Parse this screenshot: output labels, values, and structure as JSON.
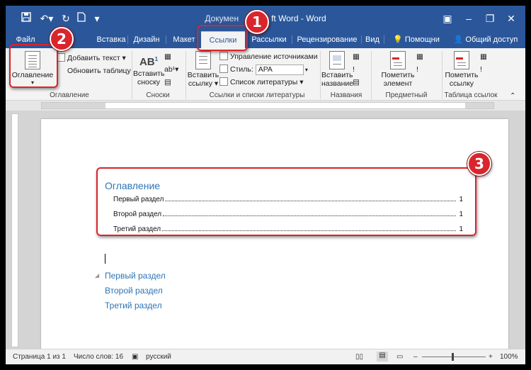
{
  "titlebar": {
    "title_prefix": "Докумен",
    "title_suffix": "ft Word - Word"
  },
  "tabs": [
    {
      "label": "Файл"
    },
    {
      "label": "Вставка"
    },
    {
      "label": "Дизайн"
    },
    {
      "label": "Макет"
    },
    {
      "label": "Ссылки",
      "active": true
    },
    {
      "label": "Рассылки"
    },
    {
      "label": "Рецензирование"
    },
    {
      "label": "Вид"
    },
    {
      "label": "Помощни"
    },
    {
      "label": "Общий доступ"
    }
  ],
  "ribbon": {
    "toc_button": "Оглавление",
    "add_text": "Добавить текст",
    "update_table": "Обновить таблицу",
    "group_toc": "Оглавление",
    "insert_footnote_l1": "Вставить",
    "insert_footnote_l2": "сноску",
    "group_footnotes": "Сноски",
    "insert_citation_l1": "Вставить",
    "insert_citation_l2": "ссылку",
    "manage_sources": "Управление источниками",
    "style_label": "Стиль:",
    "style_value": "APA",
    "bibliography": "Список литературы",
    "group_citations": "Ссылки и списки литературы",
    "insert_caption_l1": "Вставить",
    "insert_caption_l2": "название",
    "group_captions": "Названия",
    "mark_entry_l1": "Пометить",
    "mark_entry_l2": "элемент",
    "group_index": "Предметный указатель",
    "mark_citation_l1": "Пометить",
    "mark_citation_l2": "ссылку",
    "group_toa": "Таблица ссылок"
  },
  "document": {
    "toc_title": "Оглавление",
    "toc_entries": [
      {
        "label": "Первый раздел",
        "page": "1"
      },
      {
        "label": "Второй раздел",
        "page": "1"
      },
      {
        "label": "Третий раздел",
        "page": "1"
      }
    ],
    "headings": [
      "Первый раздел",
      "Второй раздел",
      "Третий раздел"
    ]
  },
  "status": {
    "page": "Страница 1 из 1",
    "words": "Число слов: 16",
    "language": "русский",
    "zoom": "100%"
  },
  "annotations": {
    "badge1": "1",
    "badge2": "2",
    "badge3": "3",
    "color": "#d9252b"
  },
  "colors": {
    "titlebar": "#2b579a",
    "heading": "#2e74b5"
  }
}
